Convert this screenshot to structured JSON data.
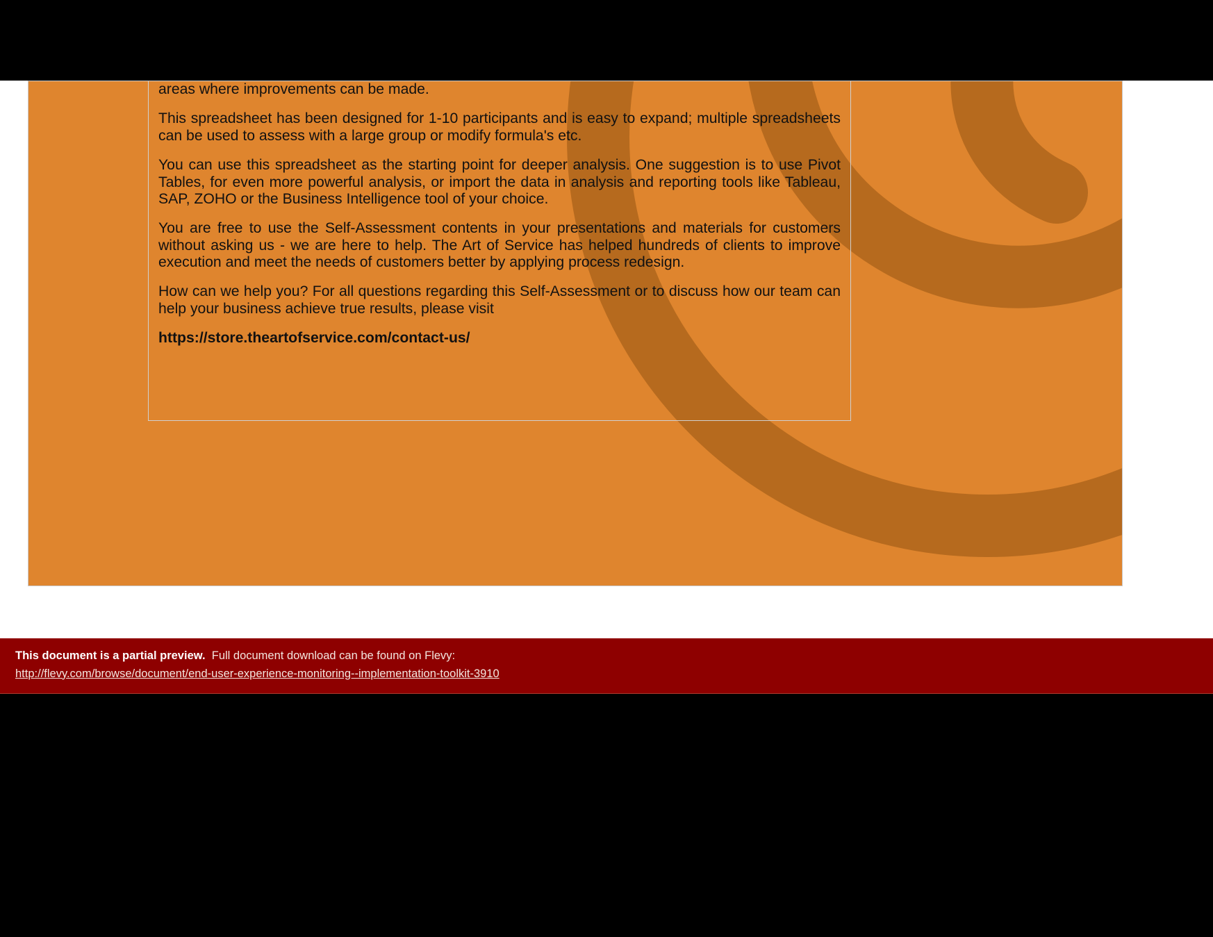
{
  "body": {
    "p1": "areas where improvements can be made.",
    "p2": "This spreadsheet has been designed for 1-10 participants and is easy to expand; multiple spreadsheets can be used to assess with a large group or modify formula's etc.",
    "p3": "You can use this spreadsheet as the starting point for deeper analysis. One suggestion is to use Pivot Tables, for even more powerful analysis, or import the data in analysis and reporting tools like Tableau, SAP, ZOHO or the Business Intelligence tool of your choice.",
    "p4": "You are free to use the Self-Assessment contents in your presentations and materials for customers without asking us - we are here to help. The Art of Service has helped hundreds of clients to improve execution and meet the needs of customers better by applying process redesign.",
    "p5": "How can we help you? For all questions regarding this Self-Assessment or to discuss how our team can help your business achieve true results, please visit",
    "p6": "https://store.theartofservice.com/contact-us/"
  },
  "preview": {
    "lead": "This document is a partial preview.",
    "rest": "Full document download can be found on Flevy:",
    "link": "http://flevy.com/browse/document/end-user-experience-monitoring--implementation-toolkit-3910"
  }
}
